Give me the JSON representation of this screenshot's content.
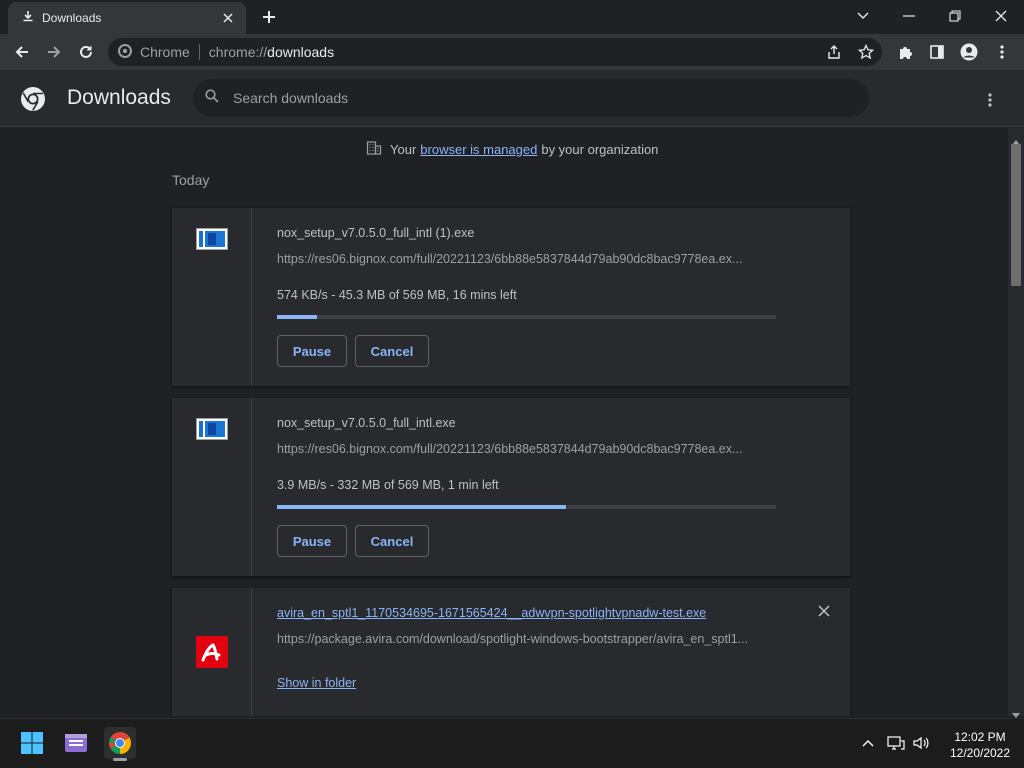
{
  "tab": {
    "title": "Downloads"
  },
  "toolbar": {
    "scheme_label": "Chrome",
    "url_scheme": "chrome://",
    "url_host": "downloads"
  },
  "header": {
    "title": "Downloads",
    "search_placeholder": "Search downloads"
  },
  "managed": {
    "prefix": "Your",
    "link": "browser is managed",
    "suffix": "by your organization"
  },
  "section": {
    "date": "Today"
  },
  "downloads": [
    {
      "filename": "nox_setup_v7.0.5.0_full_intl (1).exe",
      "url": "https://res06.bignox.com/full/20221123/6bb88e5837844d79ab90dc8bac9778ea.ex...",
      "status": "574 KB/s - 45.3 MB of 569 MB, 16 mins left",
      "progress": 0.08,
      "pause_label": "Pause",
      "cancel_label": "Cancel"
    },
    {
      "filename": "nox_setup_v7.0.5.0_full_intl.exe",
      "url": "https://res06.bignox.com/full/20221123/6bb88e5837844d79ab90dc8bac9778ea.ex...",
      "status": "3.9 MB/s - 332 MB of 569 MB, 1 min left",
      "progress": 0.58,
      "pause_label": "Pause",
      "cancel_label": "Cancel"
    },
    {
      "filename": "avira_en_sptl1_1170534695-1671565424__adwvpn-spotlightvpnadw-test.exe",
      "url": "https://package.avira.com/download/spotlight-windows-bootstrapper/avira_en_sptl1...",
      "show_folder_label": "Show in folder"
    }
  ],
  "taskbar": {
    "time": "12:02 PM",
    "date": "12/20/2022"
  },
  "colors": {
    "accent": "#8ab4f8",
    "background": "#202124",
    "card": "#292a2d"
  }
}
